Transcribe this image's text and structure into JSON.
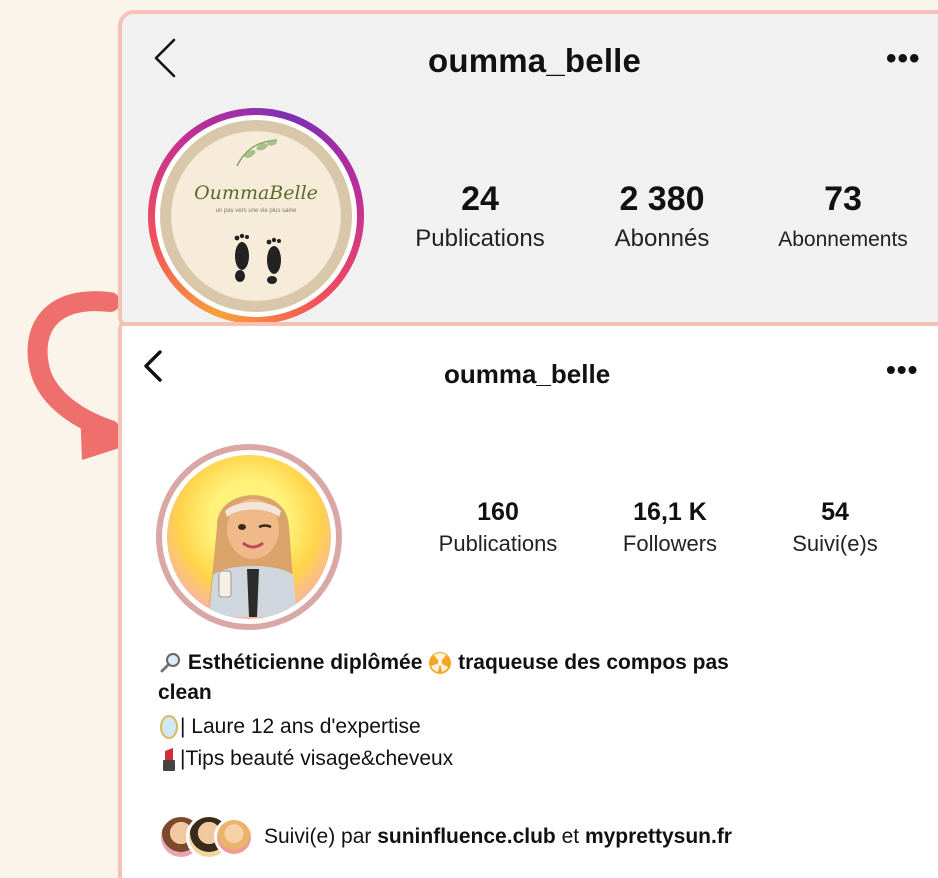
{
  "before": {
    "username": "oumma_belle",
    "logo_text": "OummaBelle",
    "logo_tagline": "un pas vers une vie plus saine",
    "stats": [
      {
        "value": "24",
        "label": "Publications"
      },
      {
        "value": "2 380",
        "label": "Abonnés"
      },
      {
        "value": "73",
        "label": "Abonnements"
      }
    ],
    "more_label": "•••"
  },
  "after": {
    "username": "oumma_belle",
    "more_label": "•••",
    "stats": [
      {
        "value": "160",
        "label": "Publications"
      },
      {
        "value": "16,1 K",
        "label": "Followers"
      },
      {
        "value": "54",
        "label": "Suivi(e)s"
      }
    ],
    "bio": {
      "line1_a": "Esthéticienne diplômée",
      "line1_b": "traqueuse des compos pas",
      "line2": "clean",
      "line3": "| Laure 12 ans d'expertise",
      "line4": "|Tips beauté visage&cheveux"
    },
    "followed_by": {
      "prefix": "Suivi(e) par",
      "account1": "suninfluence.club",
      "conjunction": "et",
      "account2": "myprettysun.fr"
    }
  },
  "colors": {
    "background": "#fbf4ea",
    "card_border": "#f7c2b6",
    "arrow": "#ef6f6c"
  }
}
